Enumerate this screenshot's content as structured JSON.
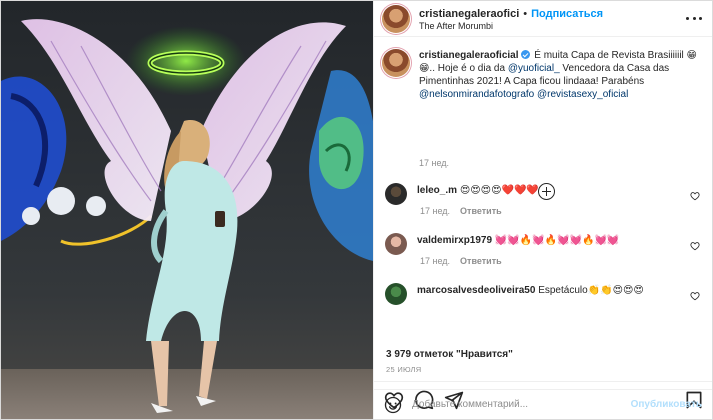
{
  "header": {
    "username": "cristianegaleraofici",
    "separator": "•",
    "follow_label": "Подписаться",
    "location": "The After Morumbi"
  },
  "caption": {
    "username": "cristianegaleraoficial",
    "text_1": " É muita Capa de Revista Brasiiiiiil 😁😁.. Hoje é o dia da ",
    "mention_1": "@yuoficial_",
    "text_2": " Vencedora da Casa das Pimentinhas 2021! A Capa ficou lindaaa! Parabéns ",
    "mention_2": "@nelsonmirandafotografo",
    "text_3": " ",
    "mention_3": "@revistasexy_oficial",
    "time": "17 нед."
  },
  "comments": [
    {
      "username": "leleo_.m",
      "text": "😍😍😍😍❤️❤️❤️",
      "time": "17 нед.",
      "reply_label": "Ответить"
    },
    {
      "username": "valdemirxp1979",
      "text": "💓💓🔥💓🔥💓💓🔥💓💓",
      "time": "17 нед.",
      "reply_label": "Ответить"
    },
    {
      "username": "marcosalvesdeoliveira50",
      "text": "Espetáculo👏👏😍😍😍"
    }
  ],
  "actions": {
    "likes_count_label": "3 979 отметок \"Нравится\"",
    "date_label": "25 ИЮЛЯ"
  },
  "add_comment": {
    "placeholder": "Добавьте комментарий...",
    "post_label": "Опубликовать"
  },
  "colors": {
    "accent": "#0095f6",
    "post_disabled": "#b2dffc",
    "verified": "#3897f0",
    "muted": "#8e8e8e"
  },
  "icons": [
    "more-icon",
    "verified-badge-icon",
    "plus-circle-icon",
    "heart-icon",
    "comment-icon",
    "share-icon",
    "bookmark-icon",
    "emoji-icon"
  ]
}
